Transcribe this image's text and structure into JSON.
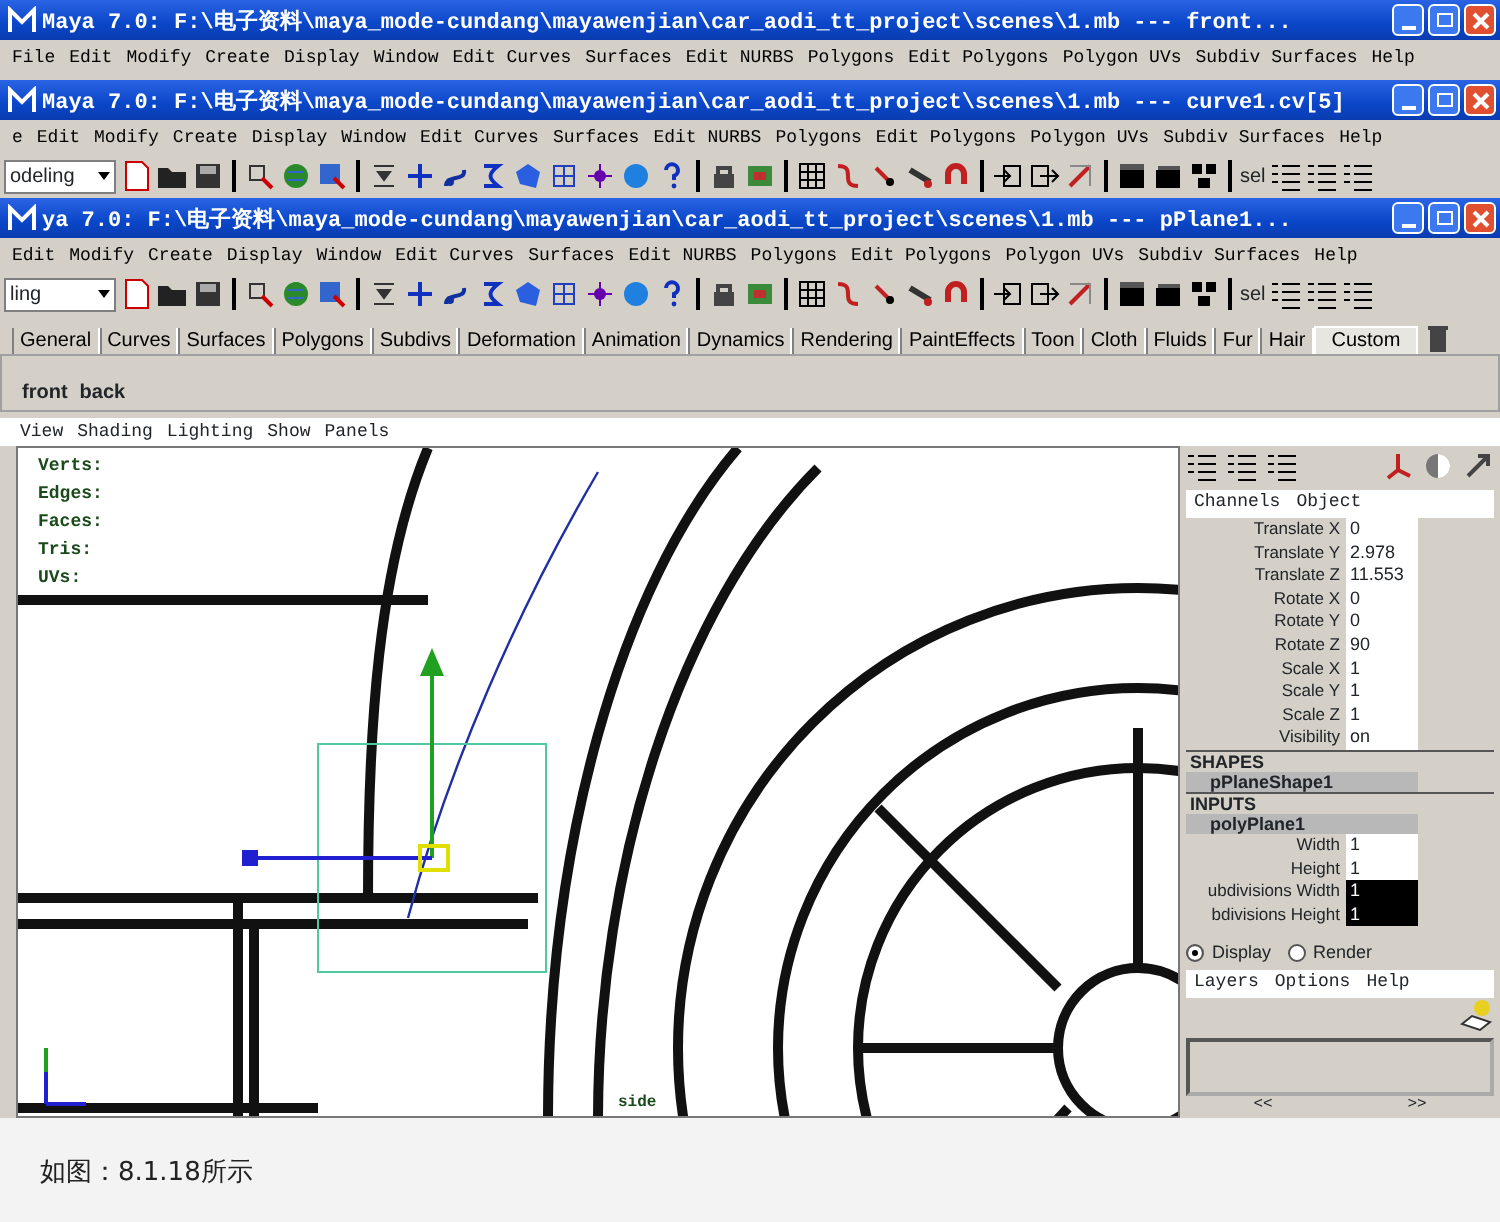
{
  "windows": [
    {
      "title": "Maya 7.0: F:\\电子资料\\maya_mode-cundang\\mayawenjian\\car_aodi_tt_project\\scenes\\1.mb   ---   front...",
      "menu": [
        "File",
        "Edit",
        "Modify",
        "Create",
        "Display",
        "Window",
        "Edit Curves",
        "Surfaces",
        "Edit NURBS",
        "Polygons",
        "Edit Polygons",
        "Polygon UVs",
        "Subdiv Surfaces",
        "Help"
      ]
    },
    {
      "title": "Maya 7.0: F:\\电子资料\\maya_mode-cundang\\mayawenjian\\car_aodi_tt_project\\scenes\\1.mb   ---   curve1.cv[5]",
      "menu": [
        "e",
        "Edit",
        "Modify",
        "Create",
        "Display",
        "Window",
        "Edit Curves",
        "Surfaces",
        "Edit NURBS",
        "Polygons",
        "Edit Polygons",
        "Polygon UVs",
        "Subdiv Surfaces",
        "Help"
      ],
      "mode": "odeling",
      "select_label": "sel"
    },
    {
      "title": "ya 7.0: F:\\电子资料\\maya_mode-cundang\\mayawenjian\\car_aodi_tt_project\\scenes\\1.mb   ---   pPlane1...",
      "menu": [
        "Edit",
        "Modify",
        "Create",
        "Display",
        "Window",
        "Edit Curves",
        "Surfaces",
        "Edit NURBS",
        "Polygons",
        "Edit Polygons",
        "Polygon UVs",
        "Subdiv Surfaces",
        "Help"
      ],
      "mode": "ling",
      "select_label": "sel"
    }
  ],
  "shelf": {
    "tabs": [
      {
        "label": "General",
        "selected": false
      },
      {
        "label": "Curves",
        "selected": false
      },
      {
        "label": "Surfaces",
        "selected": false
      },
      {
        "label": "Polygons",
        "selected": false
      },
      {
        "label": "Subdivs",
        "selected": false
      },
      {
        "label": "Deformation",
        "selected": false
      },
      {
        "label": "Animation",
        "selected": false
      },
      {
        "label": "Dynamics",
        "selected": false
      },
      {
        "label": "Rendering",
        "selected": false
      },
      {
        "label": "PaintEffects",
        "selected": false
      },
      {
        "label": "Toon",
        "selected": false
      },
      {
        "label": "Cloth",
        "selected": false
      },
      {
        "label": "Fluids",
        "selected": false
      },
      {
        "label": "Fur",
        "selected": false
      },
      {
        "label": "Hair",
        "selected": false
      },
      {
        "label": "Custom",
        "selected": true
      }
    ],
    "items": [
      "front",
      "back"
    ]
  },
  "panel_menu": [
    "View",
    "Shading",
    "Lighting",
    "Show",
    "Panels"
  ],
  "hud": [
    "Verts:",
    "Edges:",
    "Faces:",
    "Tris:",
    "UVs:"
  ],
  "viewport_label": "side",
  "channel_box": {
    "menu": [
      "Channels",
      "Object"
    ],
    "attributes": [
      {
        "name": "Translate X",
        "value": "0"
      },
      {
        "name": "Translate Y",
        "value": "2.978"
      },
      {
        "name": "Translate Z",
        "value": "11.553"
      },
      {
        "name": "Rotate X",
        "value": "0"
      },
      {
        "name": "Rotate Y",
        "value": "0"
      },
      {
        "name": "Rotate Z",
        "value": "90"
      },
      {
        "name": "Scale X",
        "value": "1"
      },
      {
        "name": "Scale Y",
        "value": "1"
      },
      {
        "name": "Scale Z",
        "value": "1"
      },
      {
        "name": "Visibility",
        "value": "on"
      }
    ],
    "shapes_header": "SHAPES",
    "shape": "pPlaneShape1",
    "inputs_header": "INPUTS",
    "input": "polyPlane1",
    "input_attributes": [
      {
        "name": "Width",
        "value": "1",
        "selected": false
      },
      {
        "name": "Height",
        "value": "1",
        "selected": false
      },
      {
        "name": "ubdivisions Width",
        "value": "1",
        "selected": true
      },
      {
        "name": "bdivisions Height",
        "value": "1",
        "selected": true
      }
    ]
  },
  "layer_editor": {
    "modes": [
      {
        "label": "Display",
        "selected": true
      },
      {
        "label": "Render",
        "selected": false
      }
    ],
    "menu": [
      "Layers",
      "Options",
      "Help"
    ],
    "pager": [
      "<<",
      ">>"
    ]
  },
  "caption": "如图：8.1.18所示"
}
